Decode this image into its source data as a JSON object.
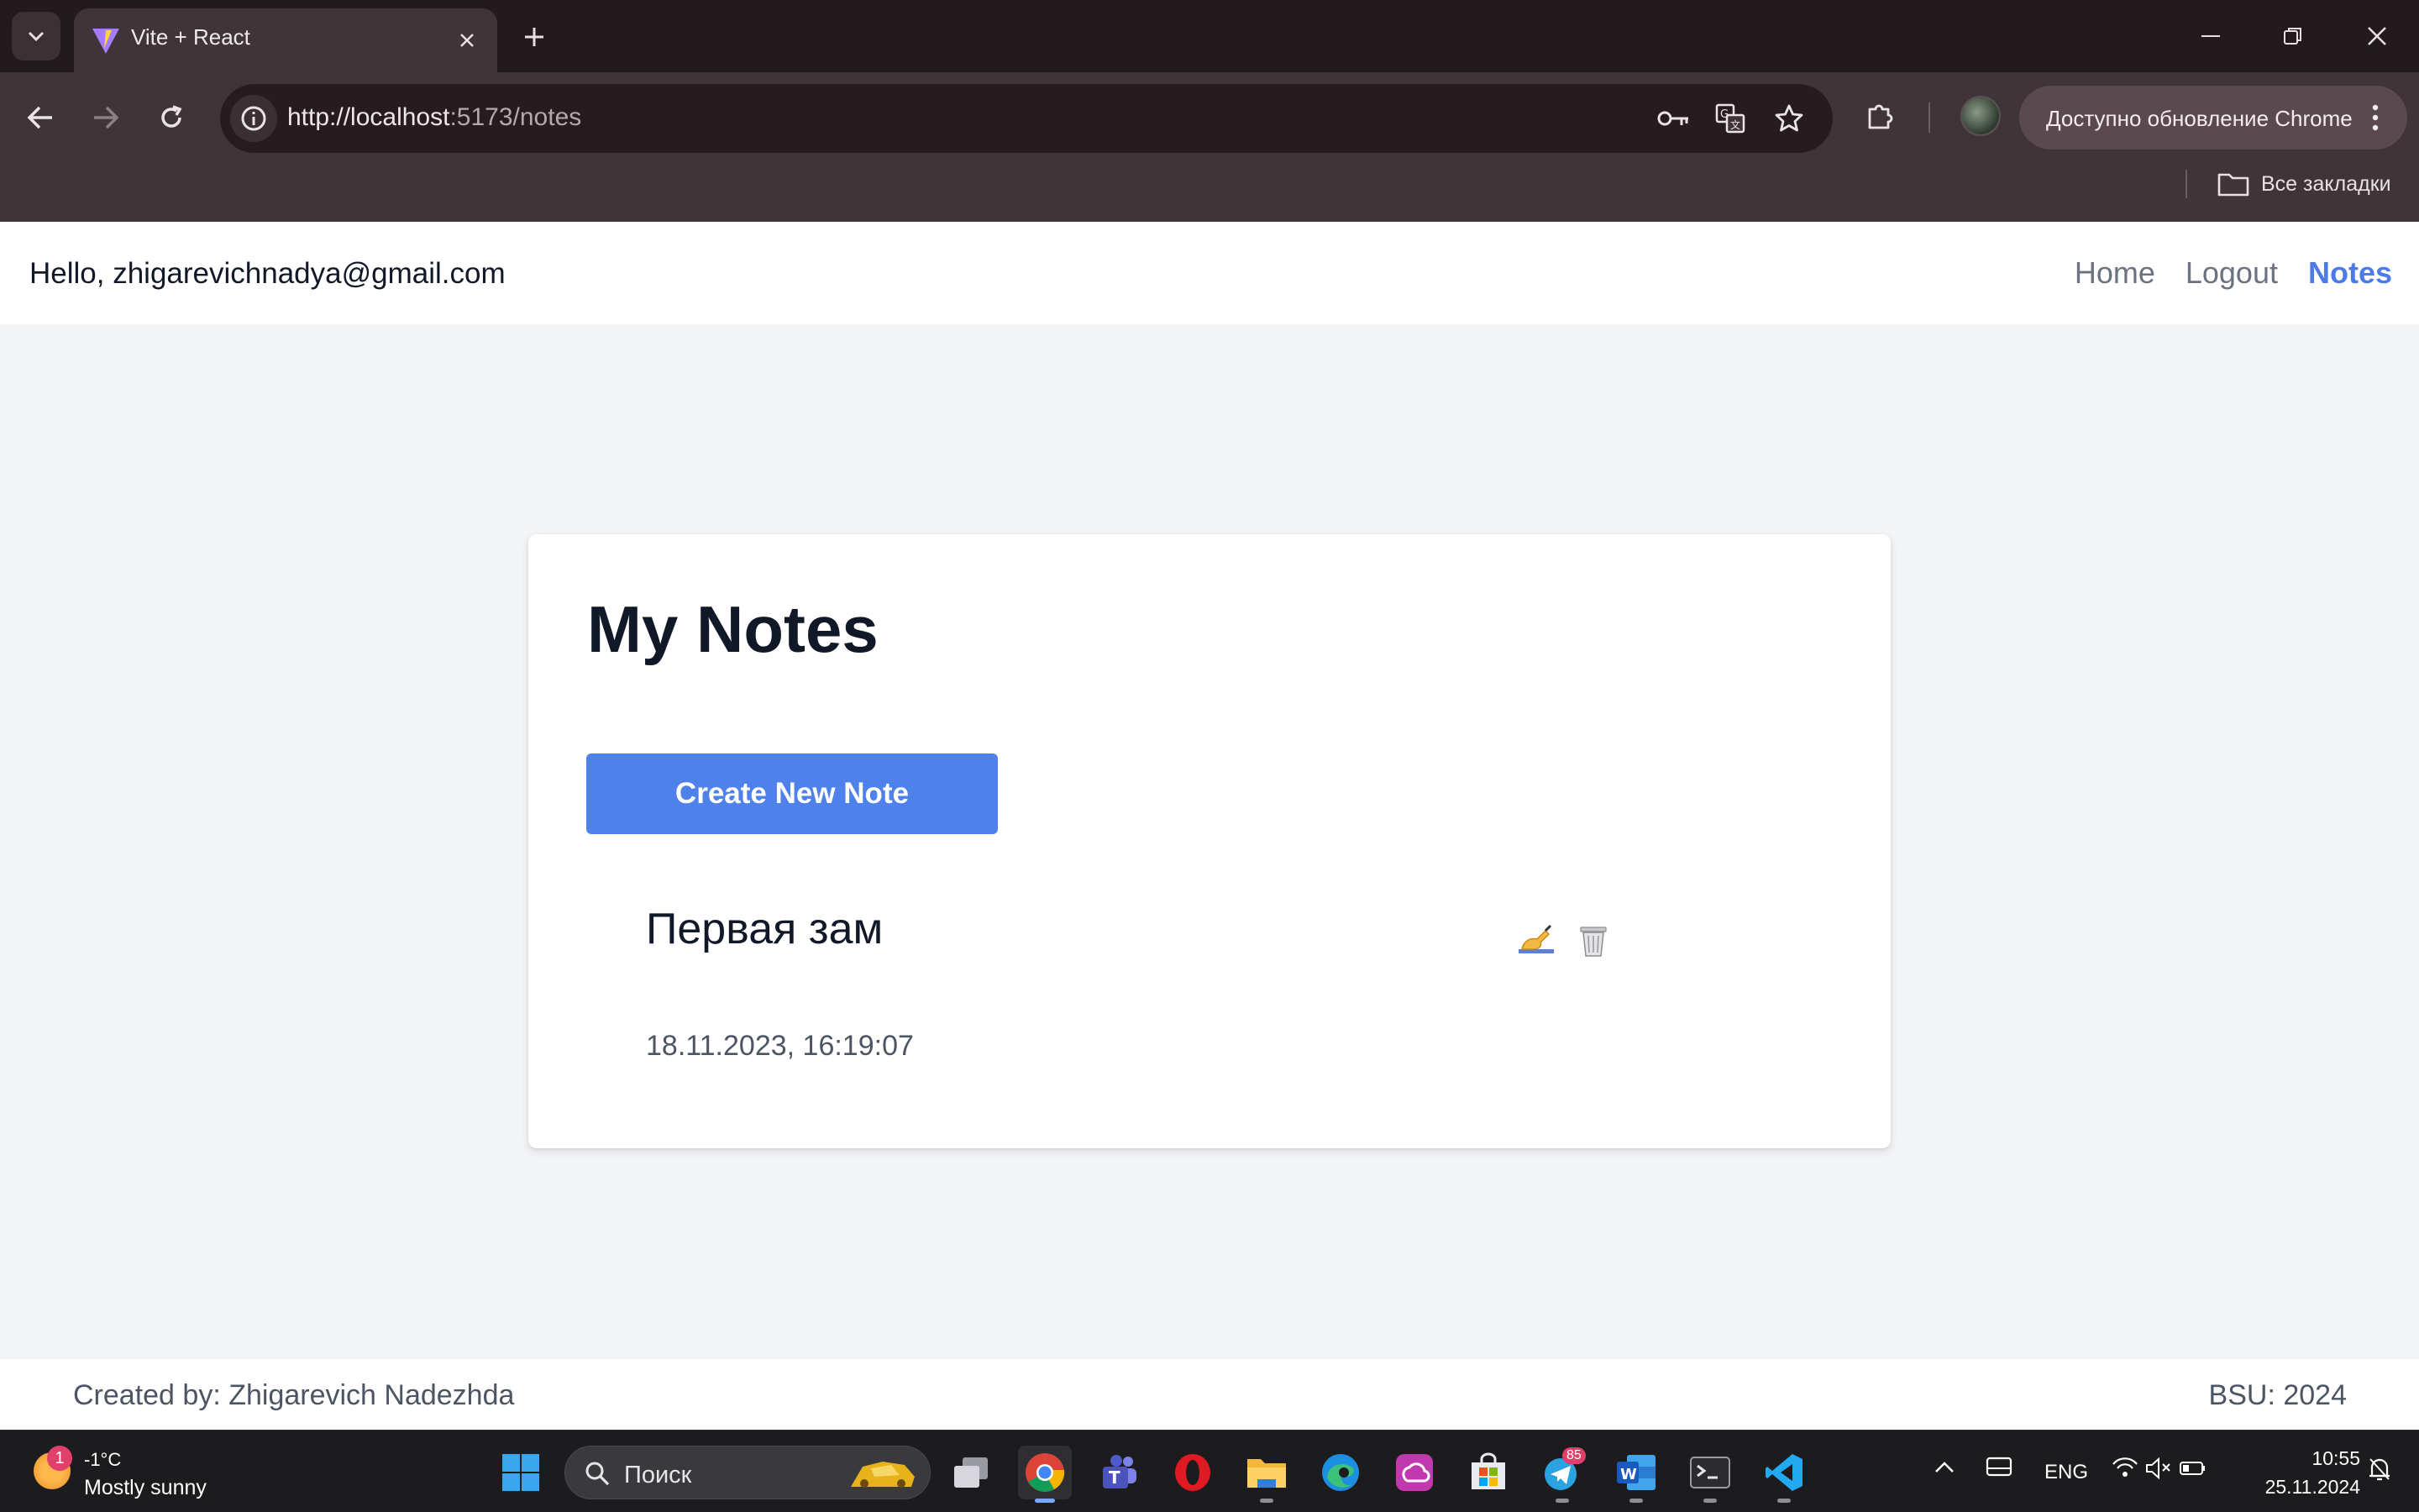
{
  "browser": {
    "tab_title": "Vite + React",
    "url_host": "http://localhost",
    "url_rest": ":5173/notes",
    "update_label": "Доступно обновление Chrome",
    "bookmarks_label": "Все закладки"
  },
  "navbar": {
    "greeting": "Hello, zhigarevichnadya@gmail.com",
    "links": {
      "home": "Home",
      "logout": "Logout",
      "notes": "Notes"
    },
    "active_color": "#4c7be8"
  },
  "main": {
    "heading": "My Notes",
    "create_button": "Create New Note",
    "notes": [
      {
        "title": "Первая зам",
        "date": "18.11.2023, 16:19:07",
        "edit_icon": "✍",
        "delete_icon": "🗑"
      }
    ]
  },
  "footer": {
    "left": "Created by: Zhigarevich Nadezhda",
    "right": "BSU: 2024"
  },
  "taskbar": {
    "weather_badge": "1",
    "temperature": "-1°C",
    "weather_condition": "Mostly sunny",
    "search_placeholder": "Поиск",
    "telegram_badge": "85",
    "language": "ENG",
    "time": "10:55",
    "date": "25.11.2024",
    "apps": [
      "task-view",
      "chrome",
      "teams",
      "opera",
      "file-explorer",
      "edge",
      "creative-cloud",
      "microsoft-store",
      "telegram",
      "word",
      "terminal",
      "vscode"
    ]
  },
  "colors": {
    "primary_button": "#4f81ea",
    "page_background": "#f3f4f6",
    "browser_frame": "#3f3538"
  }
}
